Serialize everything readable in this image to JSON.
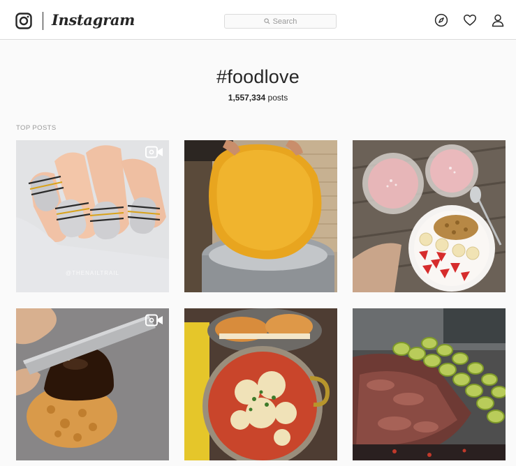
{
  "header": {
    "wordmark": "Instagram",
    "logo_icon": "instagram-camera-icon",
    "search_placeholder": "Search",
    "nav_icons": [
      "compass-icon",
      "heart-icon",
      "person-icon"
    ]
  },
  "hashtag": {
    "title": "#foodlove",
    "post_count": "1,557,334",
    "post_count_suffix": "posts"
  },
  "sections": {
    "top_posts_label": "TOP POSTS"
  },
  "posts": [
    {
      "subject": "striped metallic nail art",
      "is_video": true,
      "watermark": "@THENAILTRAIL"
    },
    {
      "subject": "large golden crispy flatbread held over pot",
      "is_video": false
    },
    {
      "subject": "smoothie bowls with granola, banana and strawberries",
      "is_video": false
    },
    {
      "subject": "knife cutting chocolate glazed cream puff",
      "is_video": true
    },
    {
      "subject": "pasta dish with cheese and herbs with bread",
      "is_video": false
    },
    {
      "subject": "grilled meat and vegetable skewers on barbecue",
      "is_video": false
    }
  ],
  "colors": {
    "accent_text": "#262626",
    "muted_text": "#999999",
    "border": "#dbdbdb",
    "background": "#fafafa"
  }
}
